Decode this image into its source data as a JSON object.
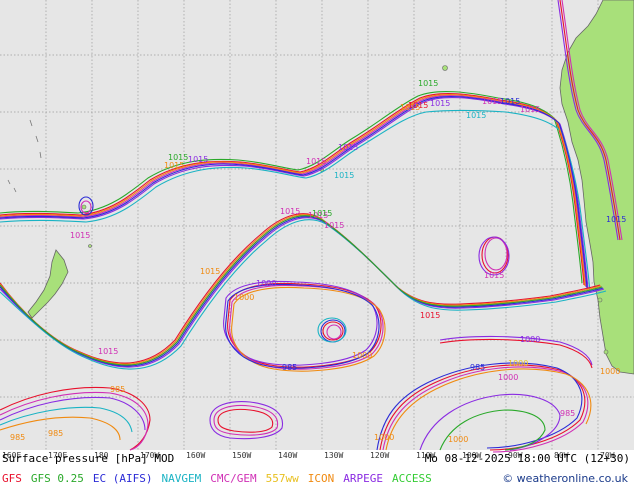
{
  "title": "Surface pressure [hPa] MOD",
  "valid_time": "Mo 08-12-2025 18:00 UTC (12+30)",
  "credit": "© weatheronline.co.uk",
  "legend": [
    {
      "label": "GFS",
      "color": "#e8112d"
    },
    {
      "label": "GFS 0.25",
      "color": "#2aa92a"
    },
    {
      "label": "EC (AIFS)",
      "color": "#2b2bd6"
    },
    {
      "label": "NAVGEM",
      "color": "#1ab3c4"
    },
    {
      "label": "CMC/GEM",
      "color": "#d02fb5"
    },
    {
      "label": "557ww",
      "color": "#e8c020"
    },
    {
      "label": "ICON",
      "color": "#f08a10"
    },
    {
      "label": "ARPEGE",
      "color": "#8a2be2"
    },
    {
      "label": "ACCESS",
      "color": "#33cc33"
    }
  ],
  "longitude_labels": [
    "160E",
    "170E",
    "180",
    "170W",
    "160W",
    "150W",
    "140W",
    "130W",
    "120W",
    "110W",
    "100W",
    "90W",
    "80W",
    "70W"
  ],
  "isobar_labels": [
    {
      "text": "1015",
      "color": "#2aa92a"
    },
    {
      "text": "1015",
      "color": "#e8112d"
    },
    {
      "text": "1015",
      "color": "#8a2be2"
    },
    {
      "text": "1015",
      "color": "#f08a10"
    },
    {
      "text": "1015",
      "color": "#1ab3c4"
    },
    {
      "text": "1015",
      "color": "#d02fb5"
    },
    {
      "text": "1015",
      "color": "#2b2bd6"
    },
    {
      "text": "1015",
      "color": "#d02fb5"
    },
    {
      "text": "1015",
      "color": "#1ab3c4"
    },
    {
      "text": "1015",
      "color": "#8a2be2"
    },
    {
      "text": "1015",
      "color": "#d02fb5"
    },
    {
      "text": "1015",
      "color": "#2aa92a"
    },
    {
      "text": "1015",
      "color": "#8a2be2"
    },
    {
      "text": "1015",
      "color": "#f08a10"
    },
    {
      "text": "1015",
      "color": "#f08a10"
    },
    {
      "text": "1015",
      "color": "#d02fb5"
    },
    {
      "text": "1015",
      "color": "#d02fb5"
    },
    {
      "text": "1015",
      "color": "#d02fb5"
    },
    {
      "text": "1015",
      "color": "#2aa92a"
    },
    {
      "text": "1015",
      "color": "#d02fb5"
    },
    {
      "text": "1015",
      "color": "#d02fb5"
    },
    {
      "text": "1015",
      "color": "#e8112d"
    },
    {
      "text": "1015",
      "color": "#d02fb5"
    },
    {
      "text": "1000",
      "color": "#8a2be2"
    },
    {
      "text": "1000",
      "color": "#f08a10"
    },
    {
      "text": "1000",
      "color": "#f08a10"
    },
    {
      "text": "1000",
      "color": "#d02fb5"
    },
    {
      "text": "1000",
      "color": "#e8c020"
    },
    {
      "text": "1000",
      "color": "#8a2be2"
    },
    {
      "text": "1000",
      "color": "#f08a10"
    },
    {
      "text": "1000",
      "color": "#f08a10"
    },
    {
      "text": "1000",
      "color": "#f08a10"
    },
    {
      "text": "985",
      "color": "#f08a10"
    },
    {
      "text": "985",
      "color": "#2b2bd6"
    },
    {
      "text": "985",
      "color": "#d02fb5"
    },
    {
      "text": "985",
      "color": "#f08a10"
    },
    {
      "text": "985",
      "color": "#f08a10"
    },
    {
      "text": "985",
      "color": "#2b2bd6"
    },
    {
      "text": "1015",
      "color": "#2b2bd6"
    }
  ]
}
